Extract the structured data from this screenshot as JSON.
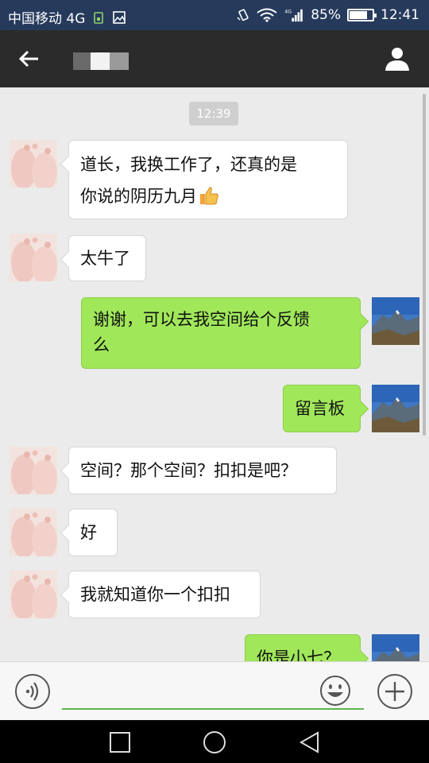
{
  "status_bar": {
    "carrier": "中国移动 4G",
    "network_type": "4G",
    "battery_percent_text": "85%",
    "battery_level": 0.85,
    "time": "12:41"
  },
  "header": {
    "back_icon": "arrow-left-icon",
    "profile_icon": "person-icon"
  },
  "chat": {
    "timestamp": "12:39",
    "messages": [
      {
        "side": "in",
        "text": "道长，我换工作了，还真的是",
        "text2": "你说的阴历九月",
        "emoji": "thumbs-up-icon"
      },
      {
        "side": "in",
        "text": "太牛了"
      },
      {
        "side": "out",
        "text": "谢谢，可以去我空间给个反馈",
        "text2": "么"
      },
      {
        "side": "out",
        "text": "留言板"
      },
      {
        "side": "in",
        "text": "空间？那个空间？扣扣是吧？"
      },
      {
        "side": "in",
        "text": "好"
      },
      {
        "side": "in",
        "text": "我就知道你一个扣扣"
      },
      {
        "side": "out",
        "text": "你是小七？"
      }
    ]
  },
  "input_bar": {
    "voice_icon": "voice-icon",
    "emoji_icon": "smiley-icon",
    "plus_icon": "plus-circle-icon",
    "input_value": ""
  },
  "colors": {
    "status_bar": "#263a5c",
    "header": "#2b2b2b",
    "chat_bg": "#ebebeb",
    "incoming_bubble": "#ffffff",
    "outgoing_bubble": "#a0e75a",
    "input_underline": "#58b94a"
  }
}
